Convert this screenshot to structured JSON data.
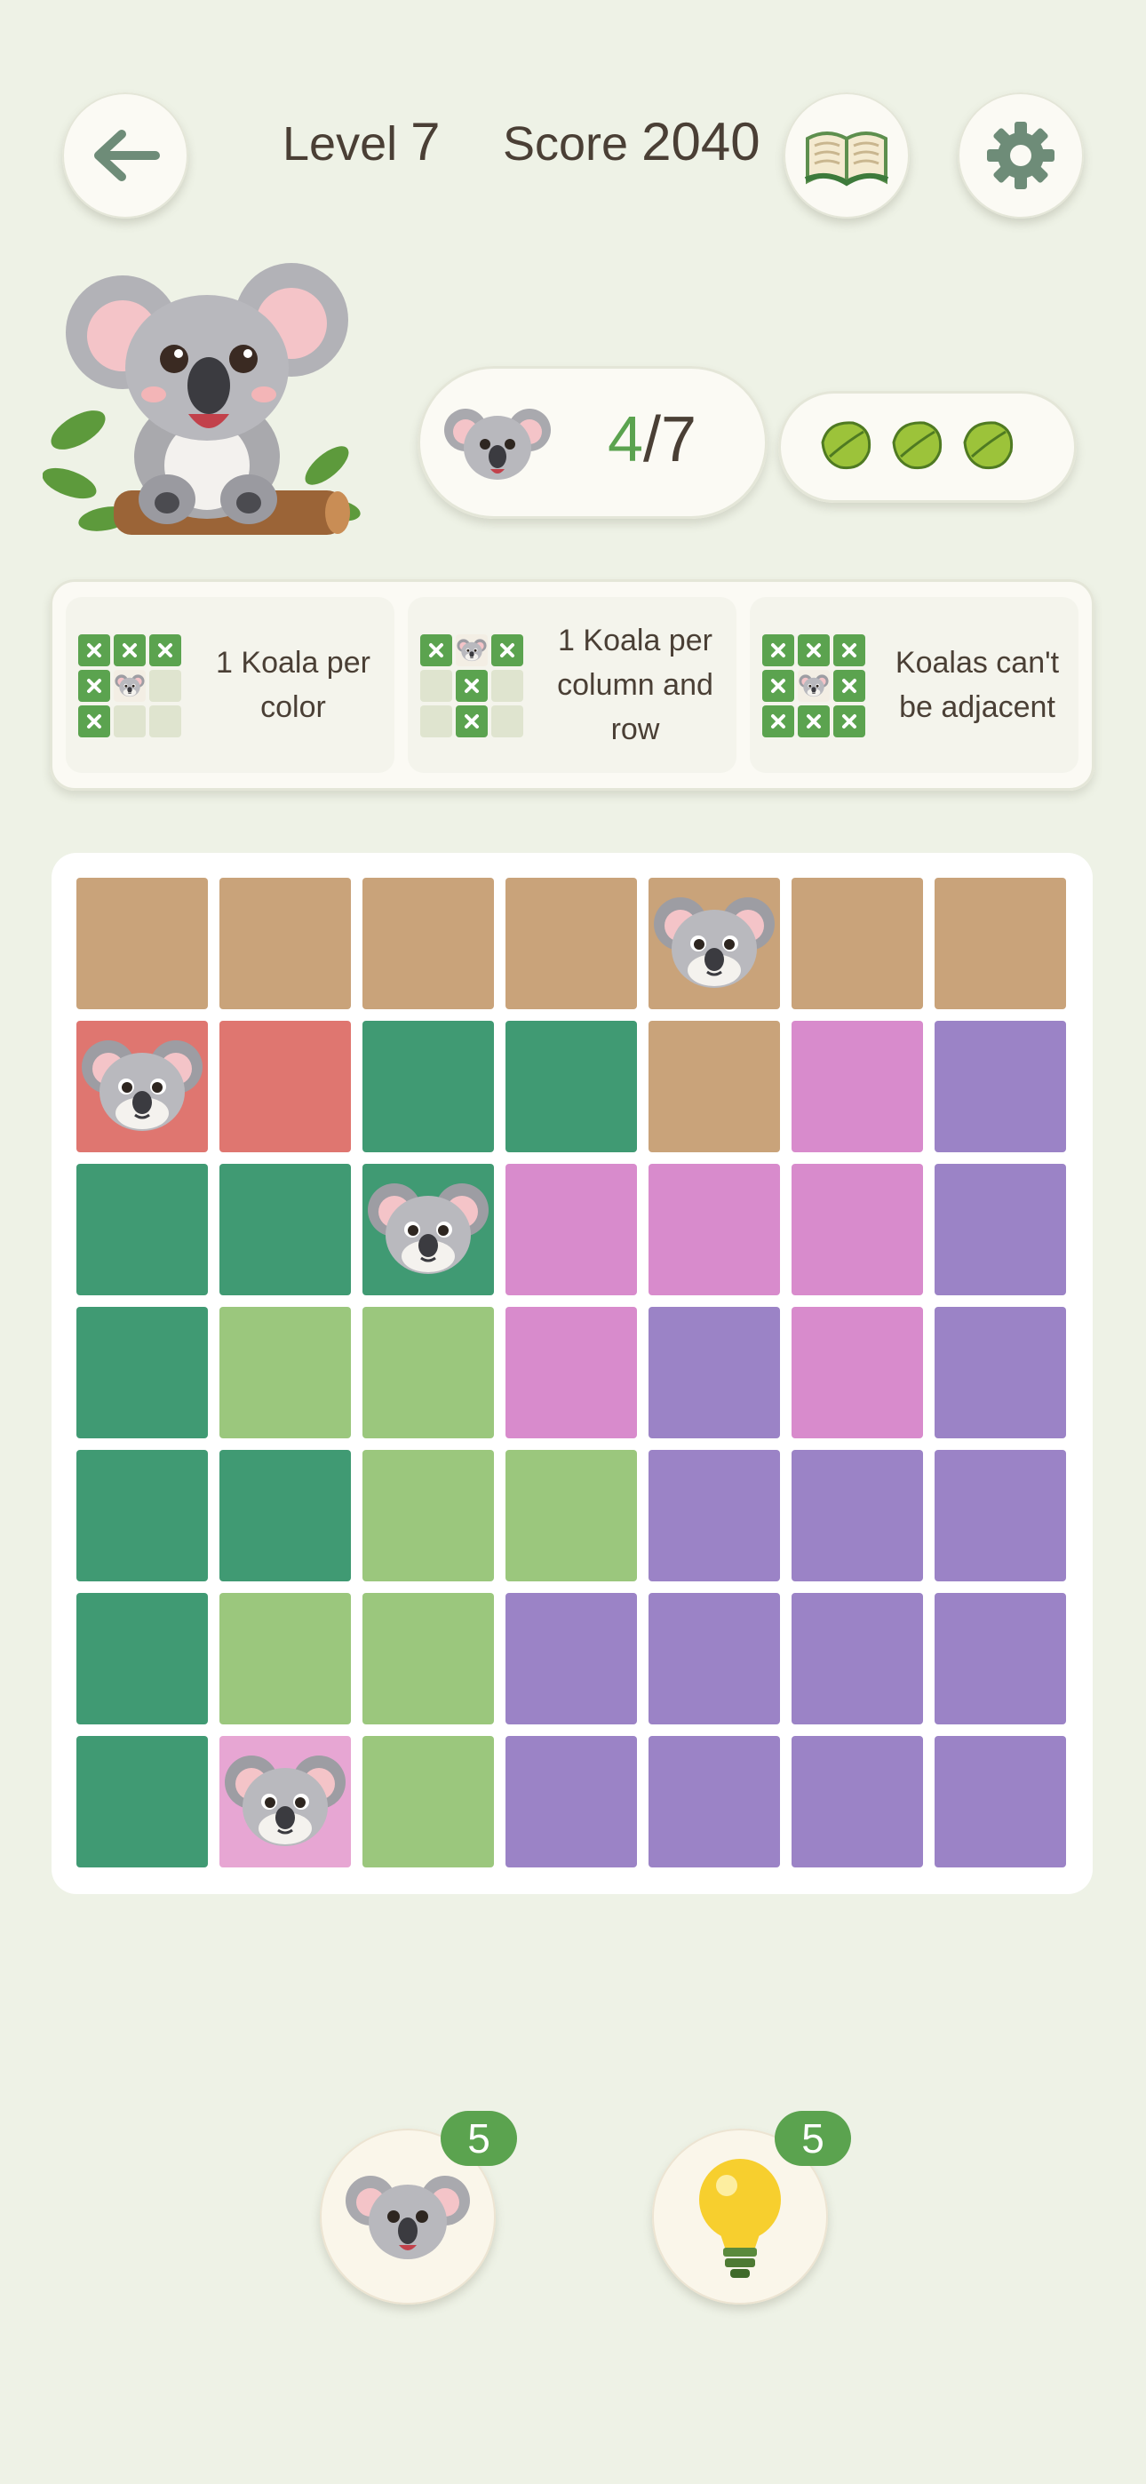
{
  "header": {
    "level_label": "Level",
    "level_value": "7",
    "score_label": "Score",
    "score_value": "2040"
  },
  "progress": {
    "found": "4",
    "total": "/7",
    "leaves": 3
  },
  "rules": [
    {
      "text": "1 Koala per color"
    },
    {
      "text": "1 Koala per column and row"
    },
    {
      "text": "Koalas can't be adjacent"
    }
  ],
  "board": {
    "size": 7,
    "colors": {
      "tan": "#c9a37a",
      "red": "#df7670",
      "green": "#409a73",
      "pink": "#d88bcc",
      "purple": "#9b83c6",
      "lightgreen": "#9bc77d"
    },
    "regions": [
      [
        "tan",
        "tan",
        "tan",
        "tan",
        "tan",
        "tan",
        "tan"
      ],
      [
        "red",
        "red",
        "green",
        "green",
        "tan",
        "pink",
        "purple"
      ],
      [
        "green",
        "green",
        "green",
        "pink",
        "pink",
        "pink",
        "purple"
      ],
      [
        "green",
        "lightgreen",
        "lightgreen",
        "pink",
        "purple",
        "pink",
        "purple"
      ],
      [
        "green",
        "green",
        "lightgreen",
        "lightgreen",
        "purple",
        "purple",
        "purple"
      ],
      [
        "green",
        "lightgreen",
        "lightgreen",
        "purple",
        "purple",
        "purple",
        "purple"
      ],
      [
        "green",
        "pink",
        "lightgreen",
        "purple",
        "purple",
        "purple",
        "purple"
      ]
    ],
    "koalas": [
      [
        0,
        4
      ],
      [
        1,
        0
      ],
      [
        2,
        2
      ],
      [
        6,
        1
      ]
    ]
  },
  "powerups": {
    "koala_count": "5",
    "hint_count": "5"
  },
  "theme": {
    "accent_green": "#5ba34f",
    "background": "#eef2e6",
    "leaf_color": "#9cc33a"
  }
}
